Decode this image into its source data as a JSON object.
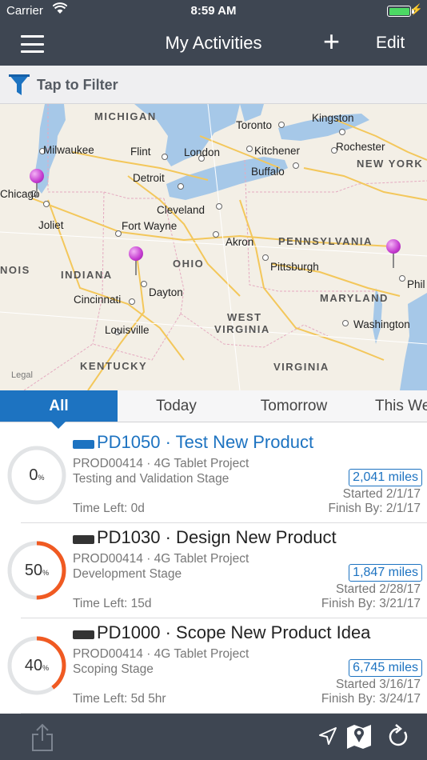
{
  "status": {
    "carrier": "Carrier",
    "time": "8:59 AM"
  },
  "nav": {
    "title": "My Activities",
    "add": "+",
    "edit": "Edit"
  },
  "filter": {
    "label": "Tap to Filter"
  },
  "map": {
    "labels": {
      "michigan": "MICHIGAN",
      "toronto": "Toronto",
      "kingston": "Kingston",
      "milwaukee": "Milwaukee",
      "flint": "Flint",
      "london": "London",
      "kitchener": "Kitchener",
      "rochester": "Rochester",
      "new_york": "NEW YORK",
      "detroit": "Detroit",
      "buffalo": "Buffalo",
      "chicago": "Chicago",
      "cleveland": "Cleveland",
      "joliet": "Joliet",
      "fort_wayne": "Fort Wayne",
      "akron": "Akron",
      "pennsylvania": "PENNSYLVANIA",
      "illinois": "NOIS",
      "indiana": "INDIANA",
      "ohio": "OHIO",
      "pittsburgh": "Pittsburgh",
      "phil": "Phil",
      "dayton": "Dayton",
      "cincinnati": "Cincinnati",
      "maryland": "MARYLAND",
      "west": "WEST",
      "virginia_w": "VIRGINIA",
      "washington": "Washington",
      "louisville": "Louisville",
      "kentucky": "KENTUCKY",
      "virginia": "VIRGINIA",
      "legal": "Legal"
    }
  },
  "tabs": [
    "All",
    "Today",
    "Tomorrow",
    "This We"
  ],
  "activities": [
    {
      "percent": 0,
      "percent_label": "0",
      "pct_sign": "%",
      "tag_color": "#1d73c1",
      "title": "PD1050 · Test New Product",
      "title_link": true,
      "project": "PROD00414 · 4G Tablet Project",
      "stage": "Testing and Validation Stage",
      "time_left": "Time Left: 0d",
      "miles": "2,041 miles",
      "started": "Started 2/1/17",
      "finish": "Finish By: 2/1/17"
    },
    {
      "percent": 50,
      "percent_label": "50",
      "pct_sign": "%",
      "tag_color": "#333333",
      "title": "PD1030 · Design New Product",
      "title_link": false,
      "project": "PROD00414 · 4G Tablet Project",
      "stage": "Development Stage",
      "time_left": "Time Left: 15d",
      "miles": "1,847 miles",
      "started": "Started 2/28/17",
      "finish": "Finish By: 3/21/17"
    },
    {
      "percent": 40,
      "percent_label": "40",
      "pct_sign": "%",
      "tag_color": "#333333",
      "title": "PD1000 · Scope New Product Idea",
      "title_link": false,
      "project": "PROD00414 · 4G Tablet Project",
      "stage": "Scoping Stage",
      "time_left": "Time Left: 5d 5hr",
      "miles": "6,745 miles",
      "started": "Started 3/16/17",
      "finish": "Finish By: 3/24/17"
    }
  ],
  "colors": {
    "accent": "#1d73c1",
    "progress": "#f05a22",
    "ring_bg": "#e2e4e6",
    "bar": "#3e4652"
  },
  "icons": {
    "share": "share-icon",
    "locate": "location-arrow-icon",
    "map": "map-icon",
    "refresh": "refresh-icon"
  }
}
